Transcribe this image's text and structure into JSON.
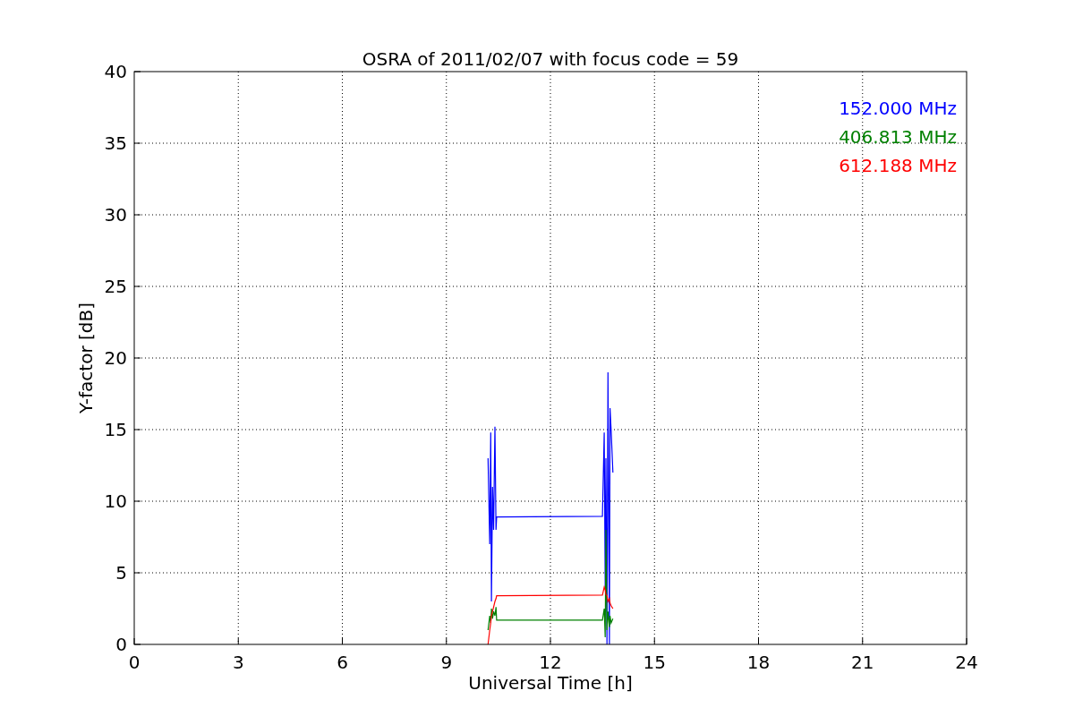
{
  "figure": {
    "chart_data": {
      "type": "line",
      "title": "OSRA of 2011/02/07 with focus code = 59",
      "xlabel": "Universal Time [h]",
      "ylabel": "Y-factor [dB]",
      "x": [
        10.2,
        10.25,
        10.28,
        10.3,
        10.33,
        10.36,
        10.4,
        10.43,
        10.45,
        13.5,
        13.55,
        13.58,
        13.6,
        13.63,
        13.66,
        13.7,
        13.72,
        13.75,
        13.8
      ],
      "series": [
        {
          "name": "152.000 MHz",
          "color": "#0000ff",
          "values": [
            13,
            7,
            14.8,
            3,
            11,
            8,
            15.2,
            8,
            8.9,
            8.95,
            14.8,
            4,
            13,
            0,
            19,
            0,
            16.5,
            15,
            12
          ]
        },
        {
          "name": "406.813 MHz",
          "color": "#008000",
          "values": [
            1,
            2,
            1.5,
            2.5,
            1.8,
            2.3,
            2,
            2.6,
            1.7,
            1.7,
            2.5,
            0.5,
            8,
            1,
            2.3,
            1.2,
            2,
            1.5,
            1.8
          ]
        },
        {
          "name": "612.188 MHz",
          "color": "#ff0000",
          "values": [
            0,
            1,
            1.5,
            2,
            2.3,
            2.6,
            3,
            3.2,
            3.4,
            3.45,
            4,
            3.8,
            3.5,
            3.4,
            3,
            3.2,
            2.9,
            2.7,
            2.5
          ]
        }
      ],
      "xlim": [
        0,
        24
      ],
      "ylim": [
        0,
        40
      ],
      "xticks": [
        0,
        3,
        6,
        9,
        12,
        15,
        18,
        21,
        24
      ],
      "yticks": [
        0,
        5,
        10,
        15,
        20,
        25,
        30,
        35,
        40
      ],
      "grid": true
    }
  }
}
